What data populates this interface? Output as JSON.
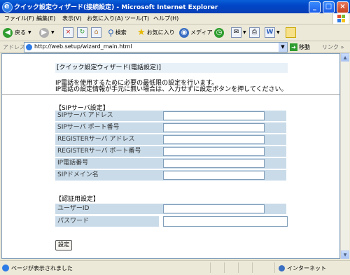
{
  "window": {
    "title": "クイック設定ウィザード(接続設定) - Microsoft Internet Explorer",
    "minimize": "_",
    "maximize": "□",
    "close": "×"
  },
  "menu": {
    "file": "ファイル(F)",
    "edit": "編集(E)",
    "view": "表示(V)",
    "favorites": "お気に入り(A)",
    "tools": "ツール(T)",
    "help": "ヘルプ(H)"
  },
  "toolbar": {
    "back": "戻る",
    "search": "検索",
    "favorites": "お気に入り",
    "media": "メディア"
  },
  "address": {
    "label": "アドレス(D)",
    "url": "http://web.setup/wizard_main.html",
    "go": "移動",
    "links": "リンク »"
  },
  "page": {
    "title": "[クイック設定ウィザード(電話設定)]",
    "desc_line1": "IP電話を使用するために必要の最低限の設定を行います。",
    "desc_line2": "IP電話の設定情報が手元に無い場合は、入力せずに設定ボタンを押してください。",
    "sip_section": "【SIPサーバ設定】",
    "sip_fields": [
      "SIPサーバ アドレス",
      "SIPサーバ ポート番号",
      "REGISTERサーバ アドレス",
      "REGISTERサーバ ポート番号",
      "IP電話番号",
      "SIPドメイン名"
    ],
    "auth_section": "【認証用設定】",
    "auth_fields": [
      "ユーザーID",
      "パスワード"
    ],
    "submit": "設定"
  },
  "status": {
    "text": "ページが表示されました",
    "zone": "インターネット"
  }
}
